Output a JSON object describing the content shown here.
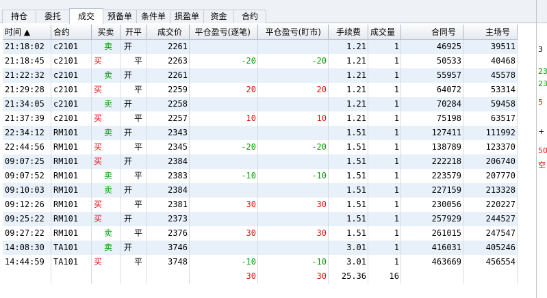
{
  "tabs": [
    {
      "label": "持仓",
      "active": false
    },
    {
      "label": "委托",
      "active": false
    },
    {
      "label": "成交",
      "active": true
    },
    {
      "label": "预备单",
      "active": false
    },
    {
      "label": "条件单",
      "active": false
    },
    {
      "label": "损盈单",
      "active": false
    },
    {
      "label": "资金",
      "active": false
    },
    {
      "label": "合约",
      "active": false
    }
  ],
  "table": {
    "columns": [
      "时间 ▲",
      "合约",
      "买卖",
      "开平",
      "成交价",
      "平仓盈亏(逐笔)",
      "平仓盈亏(盯市)",
      "手续费",
      "成交量",
      "合同号",
      "主场号"
    ],
    "rows": [
      {
        "time": "21:18:02",
        "contract": "c2101",
        "side": "卖",
        "oc": "开",
        "price": "2261",
        "pnl_trade": "",
        "pnl_mtm": "",
        "fee": "1.21",
        "qty": "1",
        "order_no": "46925",
        "exch_no": "39511"
      },
      {
        "time": "21:18:45",
        "contract": "c2101",
        "side": "买",
        "oc": "平",
        "price": "2263",
        "pnl_trade": "-20",
        "pnl_mtm": "-20",
        "fee": "1.21",
        "qty": "1",
        "order_no": "50533",
        "exch_no": "40468"
      },
      {
        "time": "21:22:32",
        "contract": "c2101",
        "side": "卖",
        "oc": "开",
        "price": "2261",
        "pnl_trade": "",
        "pnl_mtm": "",
        "fee": "1.21",
        "qty": "1",
        "order_no": "55957",
        "exch_no": "45578"
      },
      {
        "time": "21:29:28",
        "contract": "c2101",
        "side": "买",
        "oc": "平",
        "price": "2259",
        "pnl_trade": "20",
        "pnl_mtm": "20",
        "fee": "1.21",
        "qty": "1",
        "order_no": "64072",
        "exch_no": "53314"
      },
      {
        "time": "21:34:05",
        "contract": "c2101",
        "side": "卖",
        "oc": "开",
        "price": "2258",
        "pnl_trade": "",
        "pnl_mtm": "",
        "fee": "1.21",
        "qty": "1",
        "order_no": "70284",
        "exch_no": "59458"
      },
      {
        "time": "21:37:39",
        "contract": "c2101",
        "side": "买",
        "oc": "平",
        "price": "2257",
        "pnl_trade": "10",
        "pnl_mtm": "10",
        "fee": "1.21",
        "qty": "1",
        "order_no": "75198",
        "exch_no": "63517"
      },
      {
        "time": "22:34:12",
        "contract": "RM101",
        "side": "卖",
        "oc": "开",
        "price": "2343",
        "pnl_trade": "",
        "pnl_mtm": "",
        "fee": "1.51",
        "qty": "1",
        "order_no": "127411",
        "exch_no": "111992"
      },
      {
        "time": "22:44:56",
        "contract": "RM101",
        "side": "买",
        "oc": "平",
        "price": "2345",
        "pnl_trade": "-20",
        "pnl_mtm": "-20",
        "fee": "1.51",
        "qty": "1",
        "order_no": "138789",
        "exch_no": "123370"
      },
      {
        "time": "09:07:25",
        "contract": "RM101",
        "side": "买",
        "oc": "开",
        "price": "2384",
        "pnl_trade": "",
        "pnl_mtm": "",
        "fee": "1.51",
        "qty": "1",
        "order_no": "222218",
        "exch_no": "206740"
      },
      {
        "time": "09:07:52",
        "contract": "RM101",
        "side": "卖",
        "oc": "平",
        "price": "2383",
        "pnl_trade": "-10",
        "pnl_mtm": "-10",
        "fee": "1.51",
        "qty": "1",
        "order_no": "223579",
        "exch_no": "207770"
      },
      {
        "time": "09:10:03",
        "contract": "RM101",
        "side": "卖",
        "oc": "开",
        "price": "2384",
        "pnl_trade": "",
        "pnl_mtm": "",
        "fee": "1.51",
        "qty": "1",
        "order_no": "227159",
        "exch_no": "213328"
      },
      {
        "time": "09:12:26",
        "contract": "RM101",
        "side": "买",
        "oc": "平",
        "price": "2381",
        "pnl_trade": "30",
        "pnl_mtm": "30",
        "fee": "1.51",
        "qty": "1",
        "order_no": "230056",
        "exch_no": "220227"
      },
      {
        "time": "09:25:22",
        "contract": "RM101",
        "side": "买",
        "oc": "开",
        "price": "2373",
        "pnl_trade": "",
        "pnl_mtm": "",
        "fee": "1.51",
        "qty": "1",
        "order_no": "257929",
        "exch_no": "244527"
      },
      {
        "time": "09:27:22",
        "contract": "RM101",
        "side": "卖",
        "oc": "平",
        "price": "2376",
        "pnl_trade": "30",
        "pnl_mtm": "30",
        "fee": "1.51",
        "qty": "1",
        "order_no": "261015",
        "exch_no": "247547"
      },
      {
        "time": "14:08:30",
        "contract": "TA101",
        "side": "卖",
        "oc": "开",
        "price": "3746",
        "pnl_trade": "",
        "pnl_mtm": "",
        "fee": "3.01",
        "qty": "1",
        "order_no": "416031",
        "exch_no": "405246"
      },
      {
        "time": "14:44:59",
        "contract": "TA101",
        "side": "买",
        "oc": "平",
        "price": "3748",
        "pnl_trade": "-10",
        "pnl_mtm": "-10",
        "fee": "3.01",
        "qty": "1",
        "order_no": "463669",
        "exch_no": "456554"
      }
    ],
    "totals": {
      "pnl_trade": "30",
      "pnl_mtm": "30",
      "fee": "25.36",
      "qty": "16"
    }
  },
  "side_panel_fragments": [
    "3",
    "23",
    "23",
    "5",
    "+",
    "50",
    "空"
  ],
  "colors": {
    "buy": "#e01010",
    "sell": "#0a9a0a",
    "profit": "#e01010",
    "loss": "#0a9a0a",
    "row_alt": "#e8f0fa",
    "header": "#e6eaf0"
  }
}
